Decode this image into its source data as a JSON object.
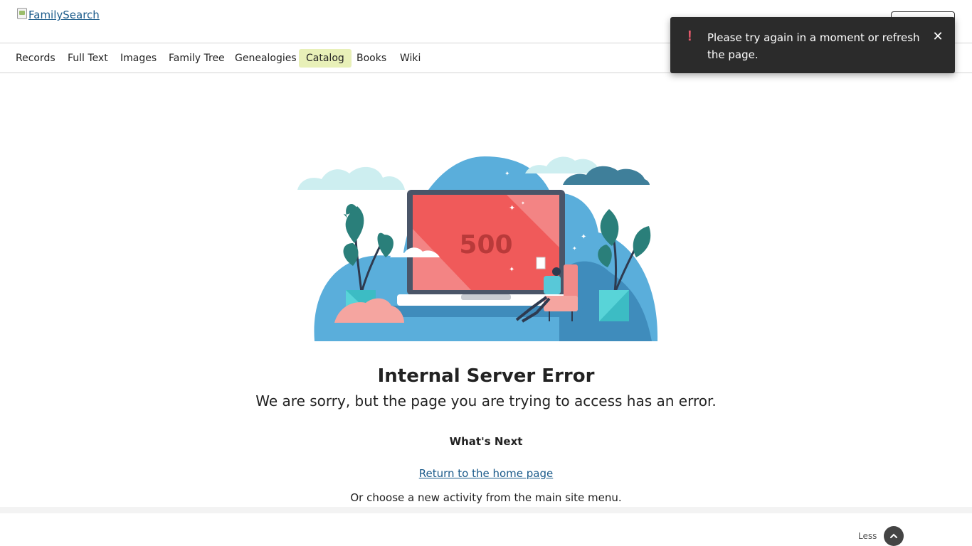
{
  "header": {
    "logo_alt": "FamilySearch"
  },
  "nav": {
    "items": [
      {
        "label": "Records"
      },
      {
        "label": "Full Text"
      },
      {
        "label": "Images"
      },
      {
        "label": "Family Tree"
      },
      {
        "label": "Genealogies"
      },
      {
        "label": "Catalog",
        "active": true
      },
      {
        "label": "Books"
      },
      {
        "label": "Wiki"
      }
    ]
  },
  "toast": {
    "icon": "exclamation-icon",
    "message": "Please try again in a moment or refresh the page.",
    "close_icon": "close-icon"
  },
  "illustration": {
    "code": "500"
  },
  "error": {
    "title": "Internal Server Error",
    "subtitle": "We are sorry, but the page you are trying to access has an error.",
    "next_heading": "What's Next",
    "home_link": "Return to the home page",
    "menu_note": "Or choose a new activity from the main site menu."
  },
  "footer": {
    "less_label": "Less",
    "less_icon": "chevron-up-icon"
  },
  "colors": {
    "nav_active_bg": "#e8f0b8",
    "toast_bg": "#2b2b2b",
    "toast_icon": "#e5596b",
    "link": "#1a5a8a",
    "screen_red": "#f05a5a",
    "sky_blue": "#5aaedb"
  }
}
